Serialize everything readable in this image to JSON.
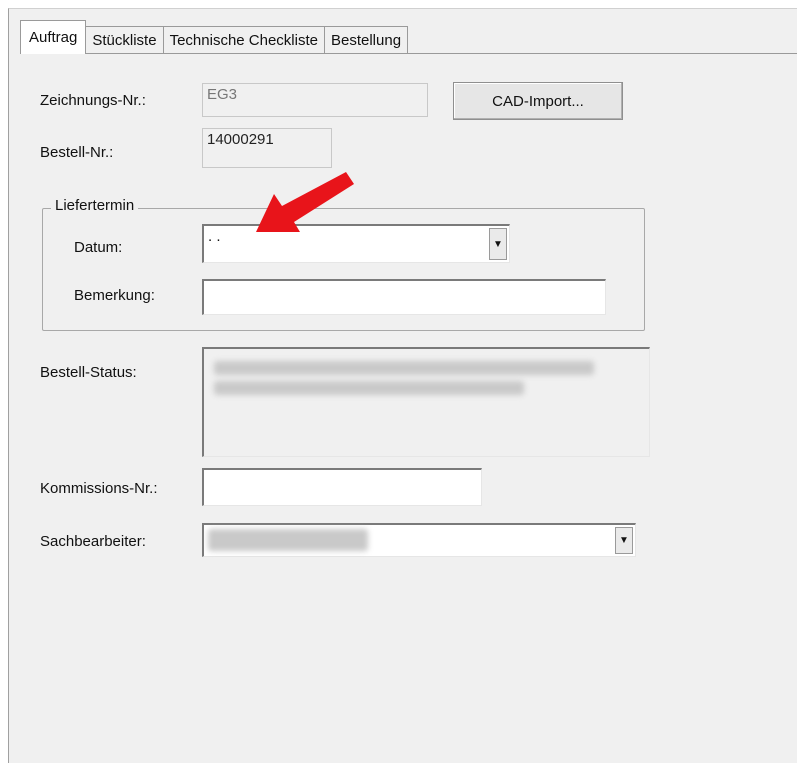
{
  "tabs": [
    {
      "label": "Auftrag",
      "active": true
    },
    {
      "label": "Stückliste",
      "active": false
    },
    {
      "label": "Technische Checkliste",
      "active": false
    },
    {
      "label": "Bestellung",
      "active": false
    }
  ],
  "form": {
    "zeichnungs_label": "Zeichnungs-Nr.:",
    "zeichnungs_value": "EG3",
    "cad_import_label": "CAD-Import...",
    "bestell_nr_label": "Bestell-Nr.:",
    "bestell_nr_value": "14000291",
    "liefertermin_title": "Liefertermin",
    "datum_label": "Datum:",
    "datum_value": ". .",
    "bemerkung_label": "Bemerkung:",
    "bemerkung_value": "",
    "bestell_status_label": "Bestell-Status:",
    "kommissions_label": "Kommissions-Nr.:",
    "kommissions_value": "",
    "sachbearbeiter_label": "Sachbearbeiter:"
  },
  "icons": {
    "dropdown": "▼",
    "annotation_arrow": "red-arrow-icon"
  },
  "colors": {
    "arrow": "#e8141a",
    "panel_bg": "#f0f0f0"
  }
}
